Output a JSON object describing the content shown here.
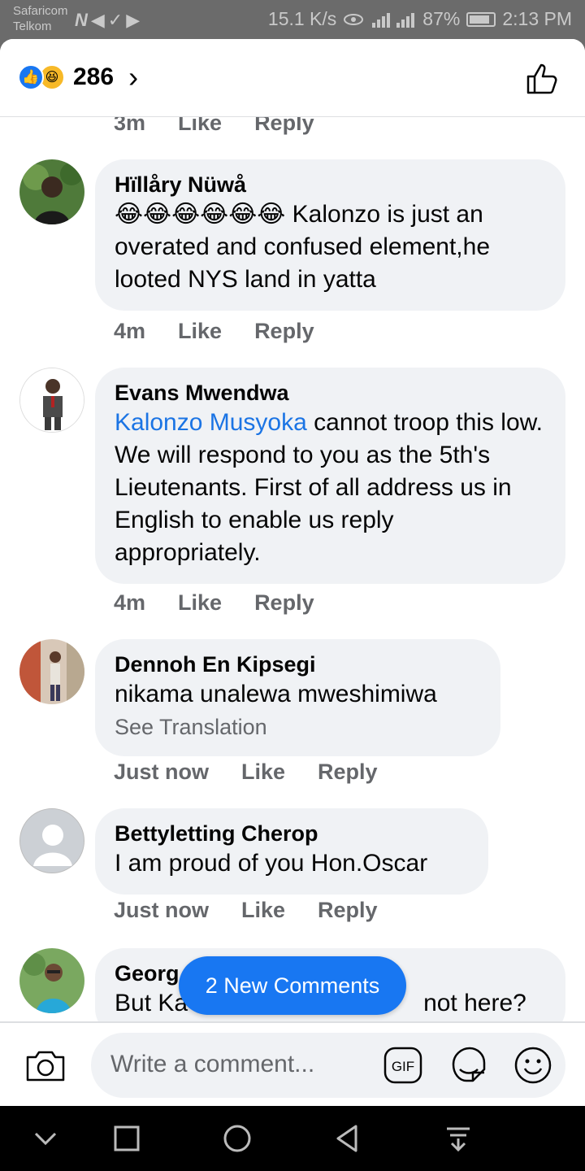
{
  "status_bar": {
    "carrier_1": "Safaricom",
    "carrier_2": "Telkom",
    "icons": "N◀✓▶",
    "speed": "15.1 K/s",
    "battery": "87%",
    "time": "2:13 PM"
  },
  "header": {
    "reaction_count": "286",
    "chevron": "›"
  },
  "comments": [
    {
      "time": "3m",
      "like": "Like",
      "reply": "Reply"
    },
    {
      "name": "Hïllåry Nüwå",
      "emojis": "😂😂😂😂😂😂",
      "text": " Kalonzo is just an overated and confused element,he looted NYS land in yatta",
      "time": "4m",
      "like": "Like",
      "reply": "Reply"
    },
    {
      "name": "Evans Mwendwa",
      "mention": "Kalonzo Musyoka",
      "text": " cannot troop this low. We will respond to you as the 5th's Lieutenants. First of all address us in English to enable us reply appropriately.",
      "time": "4m",
      "like": "Like",
      "reply": "Reply"
    },
    {
      "name": "Dennoh En Kipsegi",
      "text": "nikama unalewa mweshimiwa",
      "see_translation": "See Translation",
      "time": "Just now",
      "like": "Like",
      "reply": "Reply"
    },
    {
      "name": "Bettyletting Cherop",
      "text": "I am proud of you Hon.Oscar",
      "time": "Just now",
      "like": "Like",
      "reply": "Reply"
    },
    {
      "name": "Georg",
      "text": "But Ka",
      "text_tail": "not here?"
    }
  ],
  "new_comments_button": "2 New Comments",
  "composer": {
    "placeholder": "Write a comment...",
    "gif_label": "GIF"
  },
  "colors": {
    "accent": "#1877f2",
    "bubble": "#f0f2f5",
    "muted": "#65676b"
  }
}
